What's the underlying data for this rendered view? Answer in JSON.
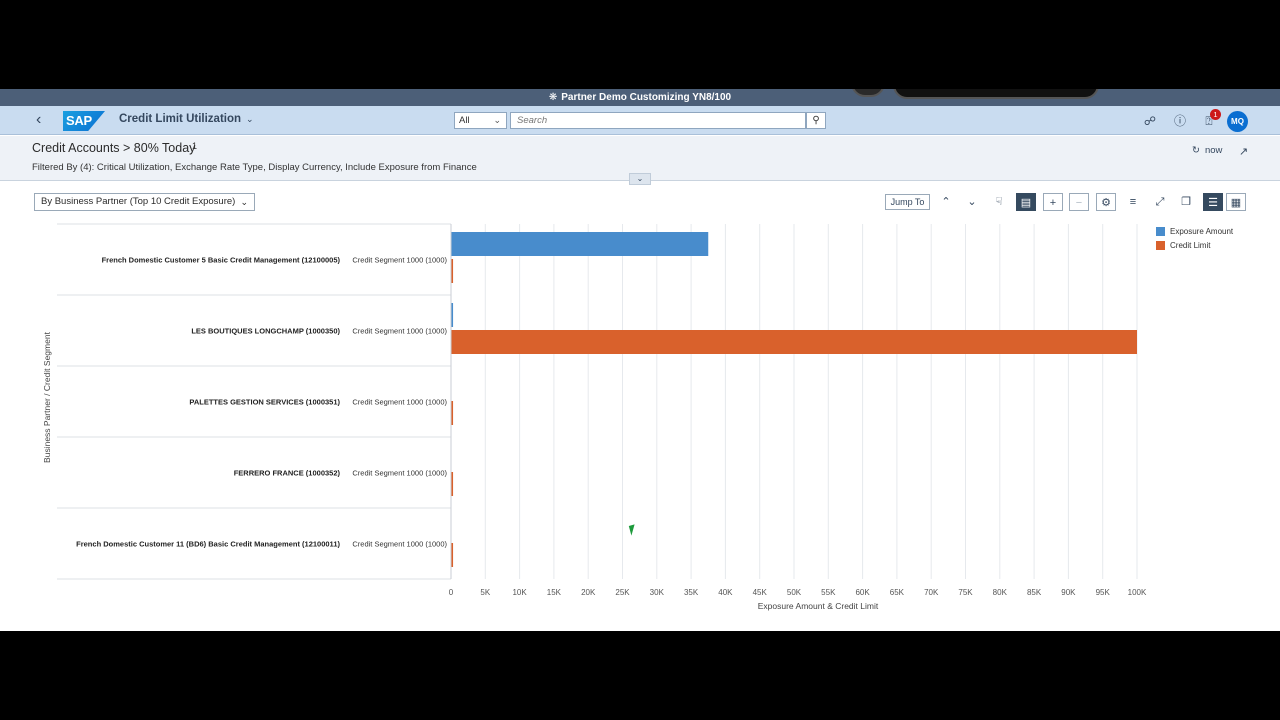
{
  "system_bar": {
    "title": "Partner Demo Customizing YN8/100",
    "icon": "org-icon"
  },
  "shell": {
    "logo_text": "SAP",
    "app_title": "Credit Limit Utilization",
    "search_scope": "All",
    "search_placeholder": "Search",
    "notification_count": "1",
    "avatar_initials": "MQ"
  },
  "header": {
    "title": "Credit Accounts > 80% Today",
    "count": "1",
    "filter_text": "Filtered By (4): Critical Utilization, Exchange Rate Type, Display Currency, Include Exposure from Finance",
    "refresh_label": "now"
  },
  "toolbar": {
    "view_select": "By Business Partner (Top 10 Credit Exposure)",
    "jump_to": "Jump To"
  },
  "colors": {
    "exposure": "#488ccc",
    "credit_limit": "#d9612c",
    "shell_bg": "#c9dcf0",
    "accent": "#0a6ed1"
  },
  "chart_data": {
    "type": "bar",
    "orientation": "horizontal",
    "categories": [
      {
        "partner": "French Domestic Customer 5 Basic Credit Management (12100005)",
        "segment": "Credit Segment 1000 (1000)"
      },
      {
        "partner": "LES BOUTIQUES LONGCHAMP (1000350)",
        "segment": "Credit Segment 1000 (1000)"
      },
      {
        "partner": "PALETTES GESTION SERVICES (1000351)",
        "segment": "Credit Segment 1000 (1000)"
      },
      {
        "partner": "FERRERO FRANCE (1000352)",
        "segment": "Credit Segment 1000 (1000)"
      },
      {
        "partner": "French Domestic Customer 11 (BD6) Basic Credit Management (12100011)",
        "segment": "Credit Segment 1000 (1000)"
      }
    ],
    "series": [
      {
        "name": "Exposure Amount",
        "values": [
          37500,
          300,
          0,
          0,
          0
        ]
      },
      {
        "name": "Credit Limit",
        "values": [
          300,
          100000,
          300,
          300,
          300
        ]
      }
    ],
    "xlabel": "Exposure Amount & Credit Limit",
    "ylabel": "Business Partner / Credit Segment",
    "xlim": [
      0,
      100000
    ],
    "ticks": [
      "0",
      "5K",
      "10K",
      "15K",
      "20K",
      "25K",
      "30K",
      "35K",
      "40K",
      "45K",
      "50K",
      "55K",
      "60K",
      "65K",
      "70K",
      "75K",
      "80K",
      "85K",
      "90K",
      "95K",
      "100K"
    ],
    "grid": true,
    "legend": "top-right"
  }
}
